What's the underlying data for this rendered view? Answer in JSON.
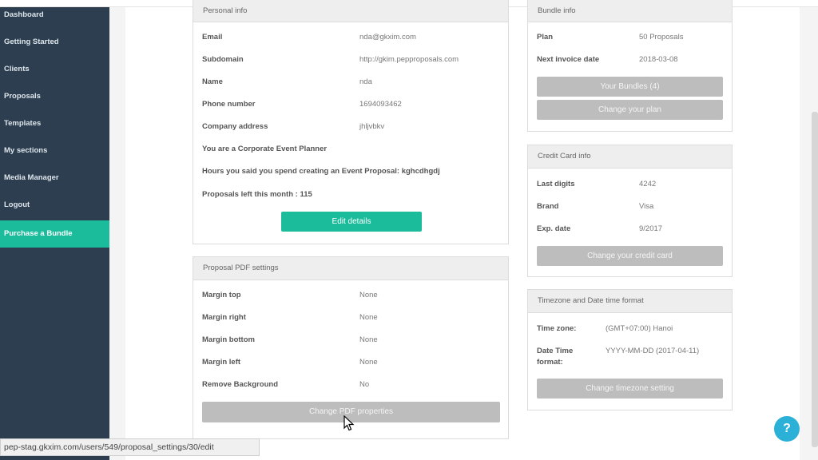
{
  "sidebar": {
    "items": [
      {
        "label": "Dashboard"
      },
      {
        "label": "Getting Started"
      },
      {
        "label": "Clients"
      },
      {
        "label": "Proposals"
      },
      {
        "label": "Templates"
      },
      {
        "label": "My sections"
      },
      {
        "label": "Media Manager"
      },
      {
        "label": "Logout"
      },
      {
        "label": "Purchase a Bundle"
      }
    ]
  },
  "personal": {
    "title": "Personal info",
    "email_label": "Email",
    "email": "nda@gkxim.com",
    "subdomain_label": "Subdomain",
    "subdomain": "http://gkim.pepproposals.com",
    "name_label": "Name",
    "name": "nda",
    "phone_label": "Phone number",
    "phone": "1694093462",
    "address_label": "Company address",
    "address": "jhljvbkv",
    "planner_text": "You are a Corporate Event Planner",
    "hours_text": "Hours you said you spend creating an Event Proposal: kghcdhgdj",
    "left_text": "Proposals left this month : 115",
    "edit_button": "Edit details"
  },
  "pdf": {
    "title": "Proposal PDF settings",
    "rows": [
      {
        "label": "Margin top",
        "value": "None"
      },
      {
        "label": "Margin right",
        "value": "None"
      },
      {
        "label": "Margin bottom",
        "value": "None"
      },
      {
        "label": "Margin left",
        "value": "None"
      },
      {
        "label": "Remove Background",
        "value": "No"
      }
    ],
    "button": "Change PDF properties"
  },
  "bundle": {
    "title": "Bundle info",
    "plan_label": "Plan",
    "plan": "50 Proposals",
    "next_label": "Next invoice date",
    "next": "2018-03-08",
    "bundles_button": "Your Bundles (4)",
    "change_plan_button": "Change your plan"
  },
  "card": {
    "title": "Credit Card info",
    "last_label": "Last digits",
    "last": "4242",
    "brand_label": "Brand",
    "brand": "Visa",
    "exp_label": "Exp. date",
    "exp": "9/2017",
    "button": "Change your credit card"
  },
  "tz": {
    "title": "Timezone and Date time format",
    "zone_label": "Time zone:",
    "zone": "(GMT+07:00) Hanoi",
    "fmt_label_1": "Date Time",
    "fmt_label_2": "format:",
    "fmt": "YYYY-MM-DD (2017-04-11)",
    "button": "Change timezone setting"
  },
  "status_url": "pep-stag.gkxim.com/users/549/proposal_settings/30/edit",
  "help_label": "?"
}
